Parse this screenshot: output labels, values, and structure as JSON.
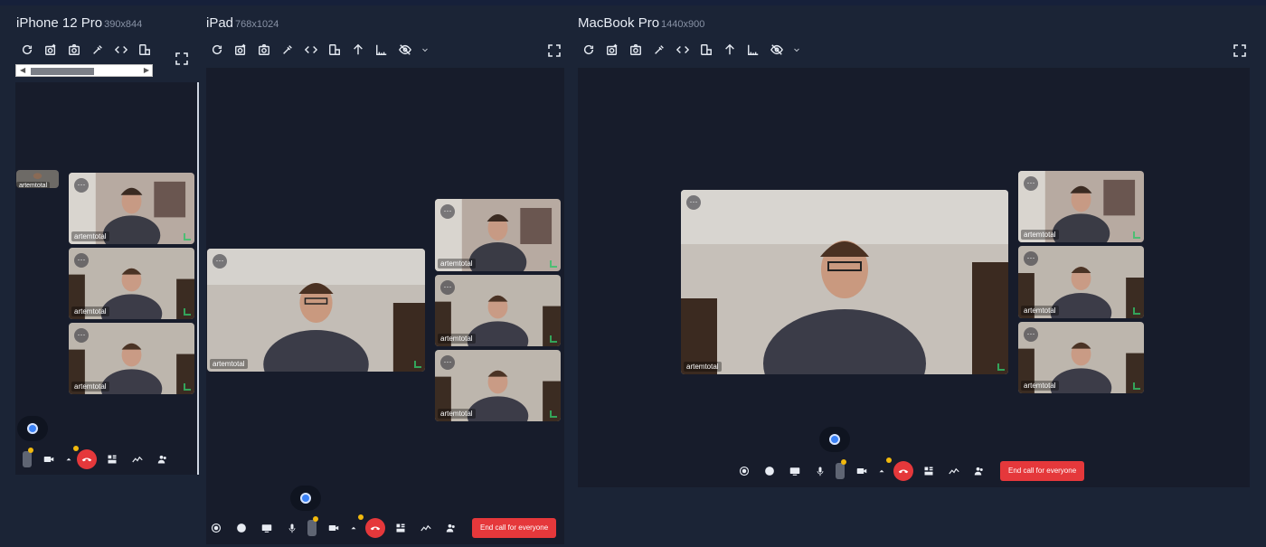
{
  "devices": [
    {
      "name": "iPhone 12 Pro",
      "res": "390x844"
    },
    {
      "name": "iPad",
      "res": "768x1024"
    },
    {
      "name": "MacBook Pro",
      "res": "1440x900"
    }
  ],
  "participant": "artemtotal",
  "end_call_label": "End call for everyone",
  "icons": {
    "toolbar": [
      "refresh-icon",
      "camera-plus-icon",
      "screenshot-icon",
      "eyedropper-icon",
      "code-icon",
      "rotate-icon",
      "arrow-up-icon",
      "ruler-icon",
      "eye-off-icon",
      "chevron-down-icon"
    ],
    "expand": "fullscreen-icon"
  },
  "colors": {
    "background": "#1b2436",
    "screen": "#171c2b",
    "hangup": "#e5383b",
    "record": "#3b82f6",
    "badge": "#f2b90d"
  }
}
